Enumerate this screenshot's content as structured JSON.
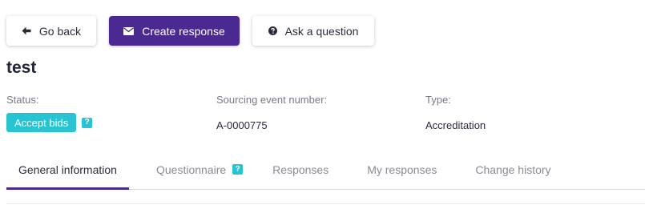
{
  "actions": {
    "back_label": "Go back",
    "create_label": "Create response",
    "ask_label": "Ask a question"
  },
  "title": "test",
  "info": {
    "status_label": "Status:",
    "status_value": "Accept bids",
    "number_label": "Sourcing event number:",
    "number_value": "A-0000775",
    "type_label": "Type:",
    "type_value": "Accreditation"
  },
  "help_glyph": "?",
  "tabs": [
    {
      "label": "General information",
      "active": true
    },
    {
      "label": "Questionnaire",
      "active": false,
      "has_help": true
    },
    {
      "label": "Responses",
      "active": false
    },
    {
      "label": "My responses",
      "active": false
    },
    {
      "label": "Change history",
      "active": false
    }
  ],
  "colors": {
    "primary": "#4a2990",
    "badge": "#29c4d4"
  },
  "icons": {
    "back": "arrow-left-icon",
    "create": "envelope-icon",
    "ask": "question-circle-icon"
  }
}
